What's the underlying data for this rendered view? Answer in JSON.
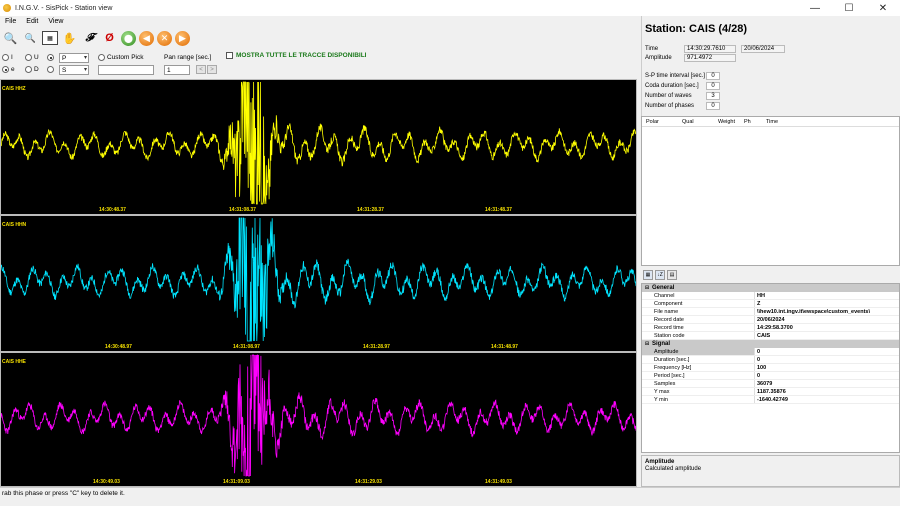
{
  "window": {
    "title": "I.N.G.V. - SisPick - Station view",
    "icon": "sun-icon",
    "controls": [
      "—",
      "☐",
      "✕"
    ]
  },
  "menu": [
    "File",
    "Edit",
    "View"
  ],
  "toolbar": {
    "icons": [
      "zoom-in-icon",
      "zoom-out-icon",
      "fit-window-icon",
      "pan-hand-icon",
      "filter-f-icon",
      "no-filter-icon",
      "save-icon",
      "previous-icon",
      "cancel-icon",
      "next-icon"
    ],
    "glyphs": [
      "🔍",
      "🔍",
      "▦",
      "✋",
      "𝓕",
      "Ø",
      "⬤",
      "◀",
      "✕",
      "▶"
    ]
  },
  "options": {
    "radio_row1": [
      {
        "label": "I",
        "checked": false
      },
      {
        "label": "U",
        "checked": false
      },
      {
        "label": "",
        "checked": true
      }
    ],
    "radio_row2": [
      {
        "label": "e",
        "checked": true
      },
      {
        "label": "D",
        "checked": false
      },
      {
        "label": "",
        "checked": false
      }
    ],
    "phase_select": "P",
    "type_select": "S",
    "custom_pick_label": "Custom Pick",
    "pan_range_label": "Pan range [sec.]",
    "pan_range_value": "1",
    "pan_buttons": [
      "<",
      ">"
    ],
    "show_all_label": "MOSTRA TUTTE LE TRACCE DISPONIBILI"
  },
  "traces": [
    {
      "label": "CAIS HHZ",
      "color": "#ffff00",
      "ticks": [
        "14:30:48.37",
        "14:31:08.37",
        "14:31:28.37",
        "14:31:48.37"
      ],
      "seed": 3,
      "amp": 0.35
    },
    {
      "label": "CAIS HHN",
      "color": "#00e5ff",
      "ticks": [
        "14:30:48.97",
        "14:31:08.97",
        "14:31:28.97",
        "14:31:48.97"
      ],
      "seed": 11,
      "amp": 0.4
    },
    {
      "label": "CAIS HHE",
      "color": "#ff00ff",
      "ticks": [
        "14:30:49.03",
        "14:31:09.03",
        "14:31:29.03",
        "14:31:49.03"
      ],
      "seed": 23,
      "amp": 0.38
    }
  ],
  "station": {
    "title": "Station: CAIS (4/28)",
    "time_label": "Time",
    "time_value": "14:30:29.7610",
    "date_value": "20/06/2024",
    "amplitude_label": "Amplitude",
    "amplitude_value": "971.4972",
    "fields": [
      {
        "label": "S-P time interval [sec.]",
        "value": "0"
      },
      {
        "label": "Coda duration [sec.]",
        "value": "0"
      },
      {
        "label": "Number of waves",
        "value": "3"
      },
      {
        "label": "Number of phases",
        "value": "0"
      }
    ]
  },
  "phase_list": {
    "columns": [
      "Polar",
      "Qual",
      "Weight",
      "Ph",
      "Time"
    ]
  },
  "prop_toolbar": [
    "▦",
    "↓Z",
    "▤"
  ],
  "properties": {
    "general_title": "General",
    "general": [
      {
        "k": "Channel",
        "v": "HH"
      },
      {
        "k": "Component",
        "v": "Z"
      },
      {
        "k": "File name",
        "v": "\\\\hew10.int.ingv.it\\ewspace\\custom_events\\"
      },
      {
        "k": "Record date",
        "v": "20/06/2024"
      },
      {
        "k": "Record time",
        "v": "14:29:58.3700"
      },
      {
        "k": "Station code",
        "v": "CAIS"
      }
    ],
    "signal_title": "Signal",
    "signal": [
      {
        "k": "Amplitude",
        "v": "0"
      },
      {
        "k": "Duration [sec.]",
        "v": "0"
      },
      {
        "k": "Frequency [Hz]",
        "v": "100"
      },
      {
        "k": "Period [sec.]",
        "v": "0"
      },
      {
        "k": "Samples",
        "v": "36079"
      },
      {
        "k": "Y max",
        "v": "1187.35876"
      },
      {
        "k": "Y min",
        "v": "-1640.42749"
      }
    ]
  },
  "description": {
    "title": "Amplitude",
    "text": "Calculated amplitude"
  },
  "status": "rab this phase or press \"C\" key to delete it."
}
